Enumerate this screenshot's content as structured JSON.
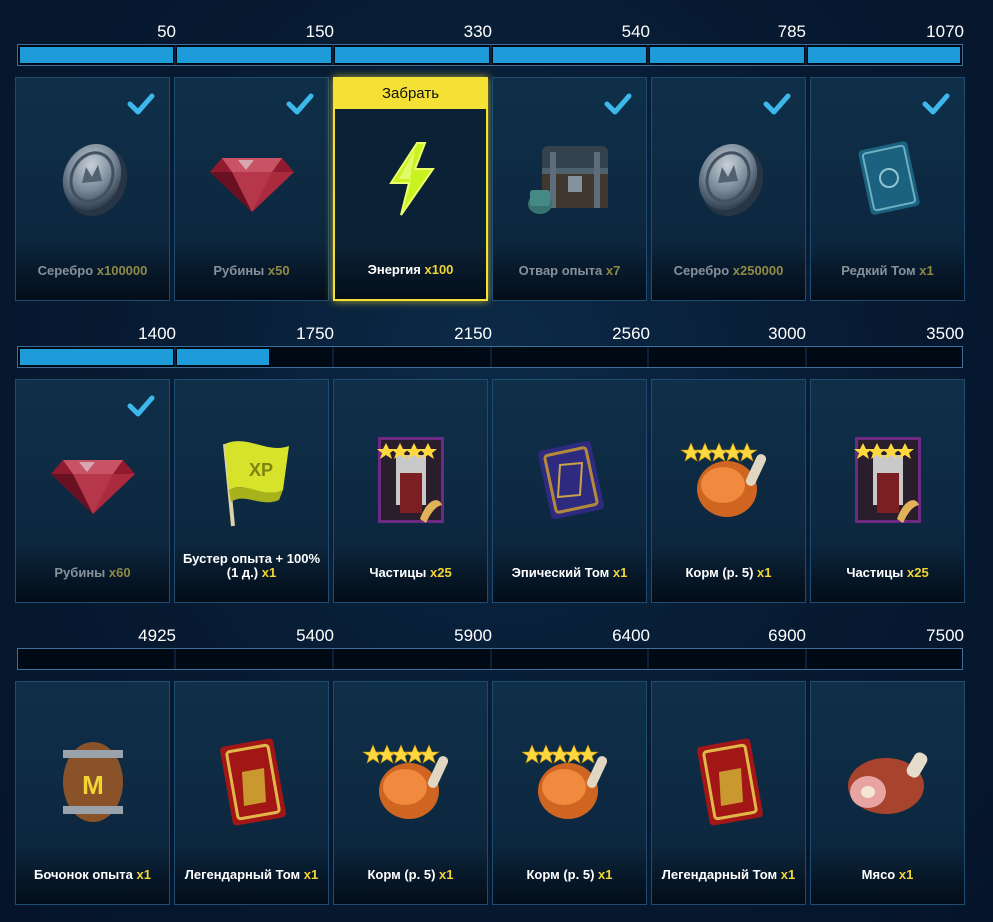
{
  "milestone_rows": [
    {
      "thresholds": [
        "50",
        "150",
        "330",
        "540",
        "785",
        "1070"
      ],
      "progress": [
        1,
        1,
        1,
        1,
        1,
        1
      ],
      "rewards": [
        {
          "icon": "silver-coin-icon",
          "name": "Серебро",
          "qty": "x100000",
          "state": "claimed"
        },
        {
          "icon": "ruby-icon",
          "name": "Рубины",
          "qty": "x50",
          "state": "claimed"
        },
        {
          "icon": "energy-bolt-icon",
          "name": "Энергия",
          "qty": "x100",
          "state": "claimable",
          "claim_label": "Забрать"
        },
        {
          "icon": "chest-brew-icon",
          "name": "Отвар опыта",
          "qty": "x7",
          "state": "claimed"
        },
        {
          "icon": "silver-coin-icon",
          "name": "Серебро",
          "qty": "x250000",
          "state": "claimed"
        },
        {
          "icon": "rare-tome-icon",
          "name": "Редкий Том",
          "qty": "x1",
          "state": "claimed"
        }
      ]
    },
    {
      "thresholds": [
        "1400",
        "1750",
        "2150",
        "2560",
        "3000",
        "3500"
      ],
      "progress": [
        1,
        0.6,
        0,
        0,
        0,
        0
      ],
      "rewards": [
        {
          "icon": "ruby-icon",
          "name": "Рубины",
          "qty": "x60",
          "state": "claimed"
        },
        {
          "icon": "xp-flag-icon",
          "name": "Бустер опыта + 100% (1 д.)",
          "qty": "x1",
          "state": "locked"
        },
        {
          "icon": "champion-shards-icon",
          "name": "Частицы",
          "qty": "x25",
          "state": "locked"
        },
        {
          "icon": "epic-tome-icon",
          "name": "Эпический Том",
          "qty": "x1",
          "state": "locked"
        },
        {
          "icon": "chicken-food-icon",
          "name": "Корм (р. 5)",
          "qty": "x1",
          "state": "locked"
        },
        {
          "icon": "champion-shards-icon",
          "name": "Частицы",
          "qty": "x25",
          "state": "locked"
        }
      ]
    },
    {
      "thresholds": [
        "4925",
        "5400",
        "5900",
        "6400",
        "6900",
        "7500"
      ],
      "progress": [
        0,
        0,
        0,
        0,
        0,
        0
      ],
      "rewards": [
        {
          "icon": "xp-barrel-icon",
          "name": "Бочонок опыта",
          "qty": "x1",
          "state": "locked"
        },
        {
          "icon": "legendary-tome-icon",
          "name": "Легендарный Том",
          "qty": "x1",
          "state": "locked"
        },
        {
          "icon": "chicken-food-icon",
          "name": "Корм (р. 5)",
          "qty": "x1",
          "state": "locked"
        },
        {
          "icon": "chicken-food-icon",
          "name": "Корм (р. 5)",
          "qty": "x1",
          "state": "locked"
        },
        {
          "icon": "legendary-tome-icon",
          "name": "Легендарный Том",
          "qty": "x1",
          "state": "locked"
        },
        {
          "icon": "meat-icon",
          "name": "Мясо",
          "qty": "x1",
          "state": "locked"
        }
      ]
    }
  ],
  "colors": {
    "progress_fill": "#1e9bd9",
    "claim_highlight": "#f5e036",
    "qty_gold": "#f2d533",
    "check": "#3db8ea"
  }
}
